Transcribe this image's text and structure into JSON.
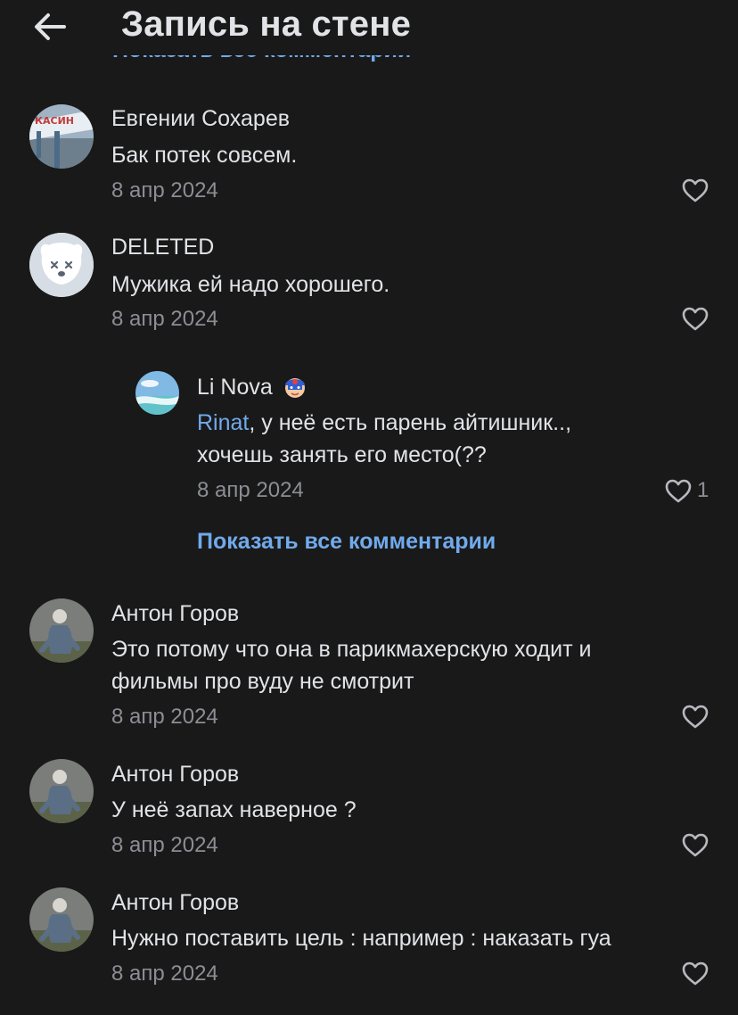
{
  "header": {
    "title": "Запись на стене",
    "back_icon": "arrow-left-icon"
  },
  "partial_show_all": "Показать все комментарии",
  "comments": [
    {
      "author": "Евгении Сохарев",
      "text": [
        "Бак потек совсем."
      ],
      "date": "8 апр 2024"
    },
    {
      "author": "DELETED",
      "text": [
        "Мужика ей надо хорошего."
      ],
      "date": "8 апр 2024"
    },
    {
      "author": "Li Nova",
      "author_badge": "🧢",
      "mention": "Rinat",
      "text": [
        ", у неё есть парень айтишник..,",
        "хочешь занять его место(??"
      ],
      "date": "8 апр 2024",
      "likes": "1"
    },
    {
      "author": "Антон Горов",
      "text": [
        "Это потому что она в парикмахерскую ходит и",
        "фильмы про вуду не смотрит"
      ],
      "date": "8 апр 2024"
    },
    {
      "author": "Антон Горов",
      "text": [
        "У неё запах наверное ?"
      ],
      "date": "8 апр 2024"
    },
    {
      "author": "Антон Горов",
      "text": [
        "Нужно поставить цель : например : наказать гуа"
      ],
      "date": "8 апр 2024"
    }
  ],
  "show_all_replies": "Показать все комментарии",
  "colors": {
    "background": "#19191a",
    "accent": "#71aaeb",
    "secondary_text": "#8c8e93"
  }
}
